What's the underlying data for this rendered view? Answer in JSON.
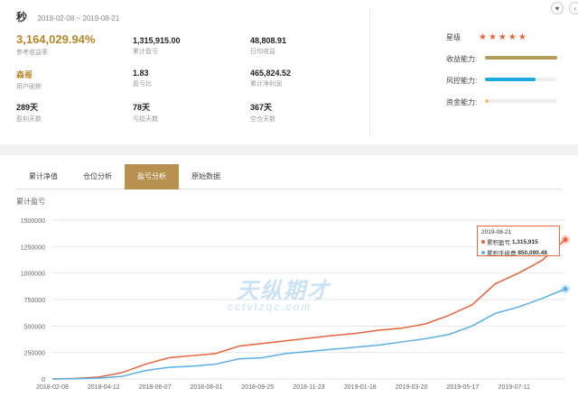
{
  "header": {
    "name": "秒",
    "date_range": "2018-02-08 ~ 2019-08-21"
  },
  "stats": {
    "return_value": "3,164,029.94%",
    "return_label": "参考收益率",
    "cum_profit_value": "1,315,915.00",
    "cum_profit_label": "累计盈亏",
    "daily_return_value": "48,808.91",
    "daily_return_label": "日均收益",
    "nickname_value": "森哥",
    "nickname_label": "用户昵称",
    "pl_ratio_value": "1.83",
    "pl_ratio_label": "盈亏比",
    "net_profit_value": "465,824.52",
    "net_profit_label": "累计净利润",
    "profit_days_value": "289天",
    "profit_days_label": "盈利天数",
    "loss_days_value": "78天",
    "loss_days_label": "亏损天数",
    "flat_days_value": "367天",
    "flat_days_label": "空仓天数"
  },
  "rating": {
    "star_label": "星级",
    "stars": "★★★★★",
    "abilities": [
      {
        "label": "收益能力:",
        "level": 1.0,
        "color": "#b69a5c"
      },
      {
        "label": "风控能力:",
        "level": 0.7,
        "color": "#1ea8e0"
      },
      {
        "label": "资金能力:",
        "level": 0.05,
        "color": "#f0c070"
      }
    ]
  },
  "actions": {
    "favorite_icon": "heart-icon",
    "more_icon": "chevron-left-icon"
  },
  "tabs": [
    {
      "label": "累计净值",
      "active": false
    },
    {
      "label": "仓位分析",
      "active": false
    },
    {
      "label": "盈亏分析",
      "active": true
    },
    {
      "label": "原始数据",
      "active": false
    }
  ],
  "chart_title": "累计盈亏",
  "watermark": {
    "line1": "天纵期才",
    "line2": "cctvtzqc.com"
  },
  "chart_data": {
    "type": "line",
    "title": "",
    "ylabel": "累计盈亏",
    "ylim": [
      0,
      1500000
    ],
    "yticks": [
      0,
      250000,
      500000,
      750000,
      1000000,
      1250000,
      1500000
    ],
    "xticks": [
      "2018-02-08",
      "2018-04-12",
      "2018-06-07",
      "2018-08-01",
      "2018-09-25",
      "2018-11-23",
      "2019-01-18",
      "2019-03-20",
      "2019-05-17",
      "2019-07-11"
    ],
    "grid": true,
    "series": [
      {
        "name": "累积盈亏",
        "color": "#e8643c",
        "values": [
          0,
          5000,
          18000,
          60000,
          140000,
          200000,
          220000,
          240000,
          310000,
          335000,
          360000,
          385000,
          410000,
          430000,
          460000,
          480000,
          520000,
          600000,
          700000,
          900000,
          1000000,
          1120000,
          1315915
        ]
      },
      {
        "name": "累积手续费",
        "color": "#5ab0e8",
        "values": [
          0,
          2000,
          8000,
          25000,
          80000,
          110000,
          120000,
          140000,
          190000,
          200000,
          240000,
          260000,
          280000,
          300000,
          320000,
          350000,
          380000,
          420000,
          500000,
          620000,
          680000,
          760000,
          850090.48
        ]
      }
    ],
    "tooltip": {
      "date": "2019-08-21",
      "profit_label": "累积盈亏:",
      "profit_value": "1,315,915",
      "fee_label": "累积手续费:",
      "fee_value": "850,090.48"
    }
  }
}
